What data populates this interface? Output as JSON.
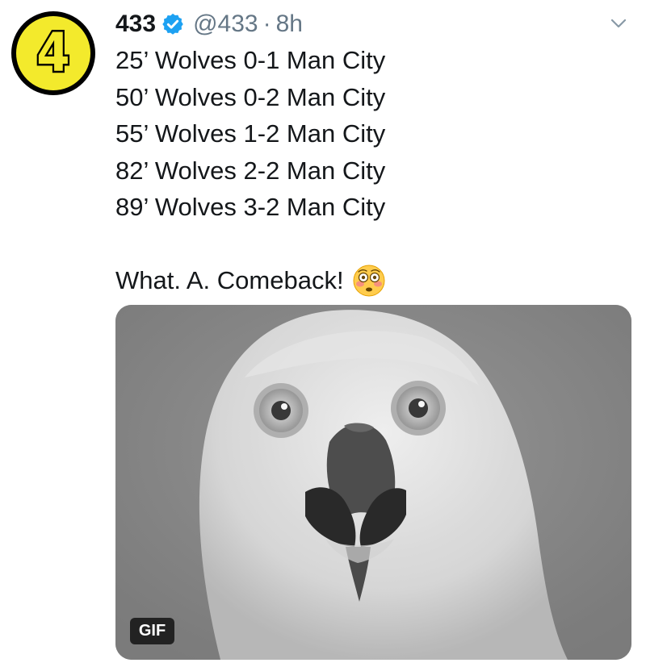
{
  "tweet": {
    "display_name": "433",
    "handle": "@433",
    "separator": "·",
    "time": "8h",
    "avatar_text": "4",
    "lines": [
      "25’ Wolves 0-1 Man City",
      "50’ Wolves 0-2 Man City",
      "55’ Wolves 1-2 Man City",
      "82’ Wolves 2-2 Man City",
      "89’ Wolves 3-2 Man City"
    ],
    "comeback": "What. A. Comeback!",
    "emoji_name": "flushed-face-emoji",
    "icons": {
      "verified": "verified-badge-icon",
      "more": "chevron-down-icon"
    }
  },
  "media": {
    "badge": "GIF",
    "subject": "owl-gif"
  },
  "colors": {
    "verified_blue": "#1da1f2",
    "avatar_yellow": "#f3ea2c",
    "secondary_text": "#657786"
  }
}
